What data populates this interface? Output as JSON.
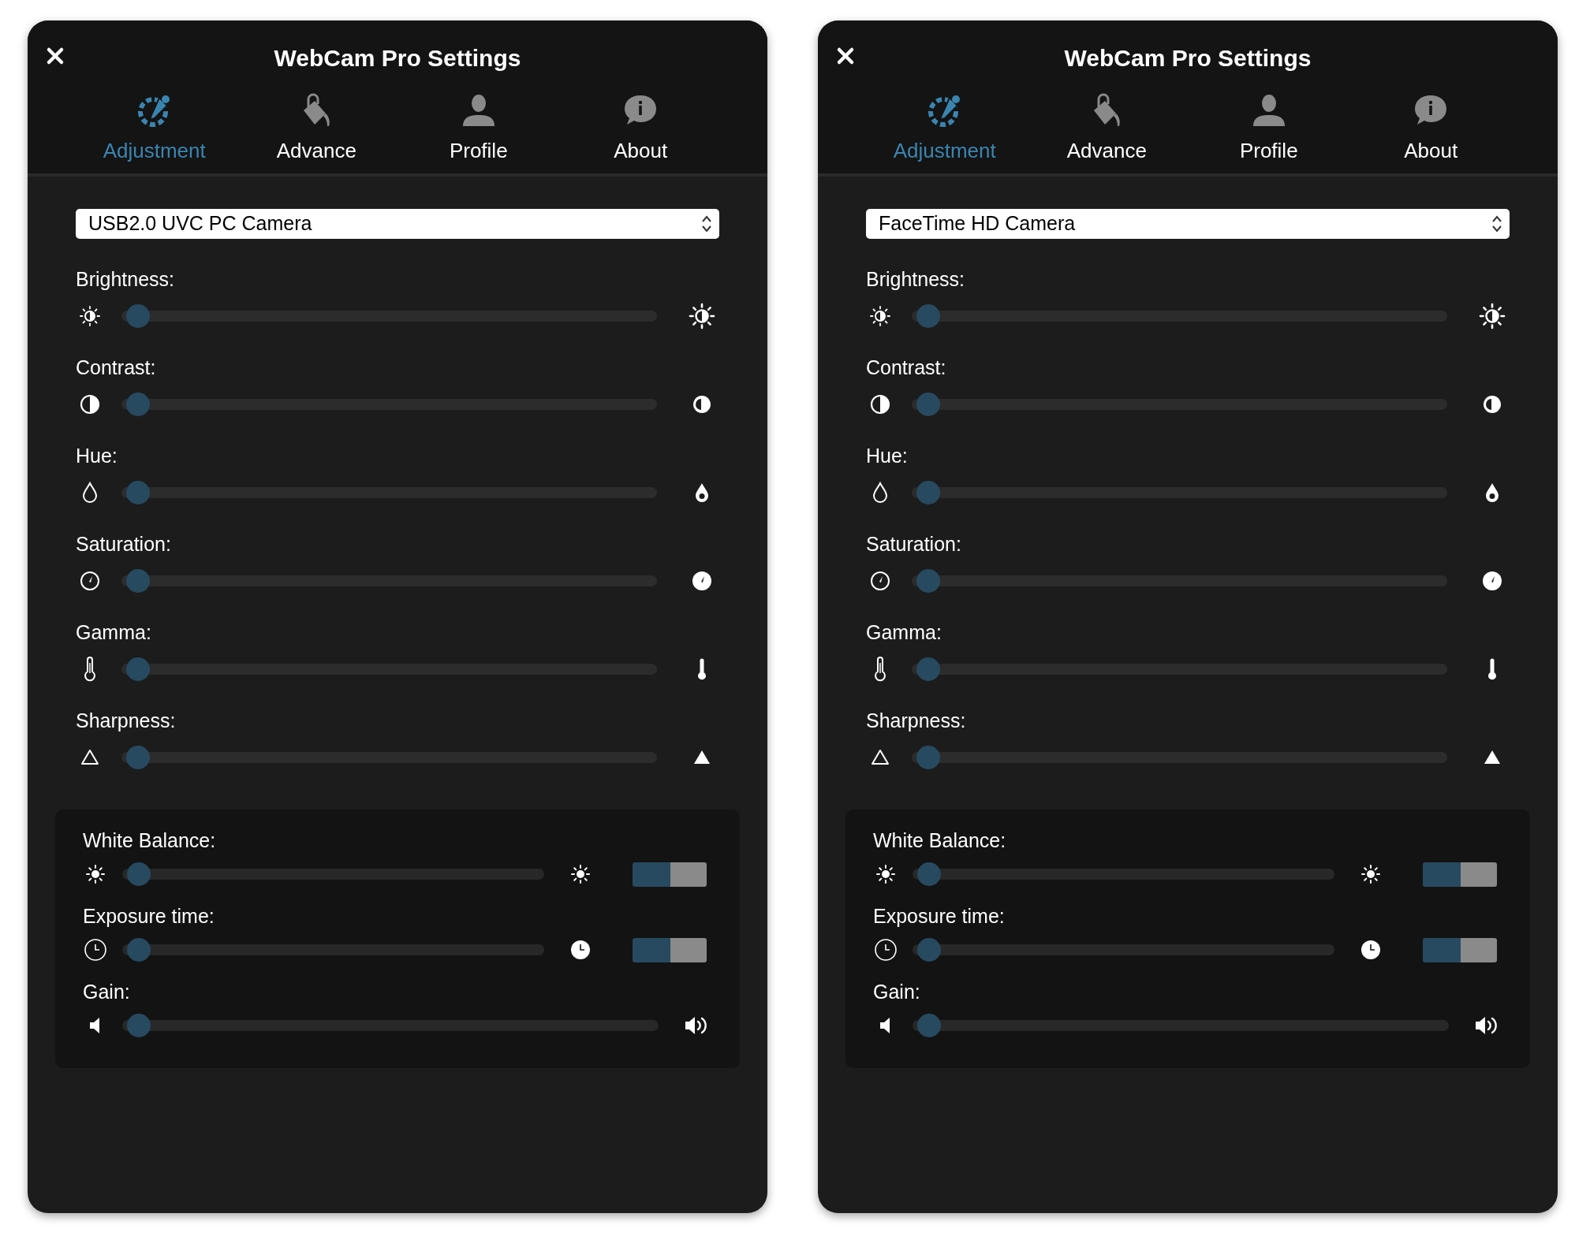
{
  "panels": [
    {
      "title": "WebCam Pro Settings",
      "tabs": [
        {
          "label": "Adjustment",
          "selected": true
        },
        {
          "label": "Advance",
          "selected": false
        },
        {
          "label": "Profile",
          "selected": false
        },
        {
          "label": "About",
          "selected": false
        }
      ],
      "camera_select": {
        "value": "USB2.0 UVC PC Camera"
      },
      "sliders": [
        {
          "label": "Brightness:",
          "level": 0
        },
        {
          "label": "Contrast:",
          "level": 0
        },
        {
          "label": "Hue:",
          "level": 0
        },
        {
          "label": "Saturation:",
          "level": 0
        },
        {
          "label": "Gamma:",
          "level": 0
        },
        {
          "label": "Sharpness:",
          "level": 0
        }
      ],
      "advanced": [
        {
          "label": "White Balance:",
          "kind": "auto",
          "level": 0,
          "on": true
        },
        {
          "label": "Exposure time:",
          "kind": "auto",
          "level": 0,
          "on": true
        },
        {
          "label": "Gain:",
          "kind": "plain",
          "level": 0
        }
      ]
    },
    {
      "title": "WebCam Pro Settings",
      "tabs": [
        {
          "label": "Adjustment",
          "selected": true
        },
        {
          "label": "Advance",
          "selected": false
        },
        {
          "label": "Profile",
          "selected": false
        },
        {
          "label": "About",
          "selected": false
        }
      ],
      "camera_select": {
        "value": "FaceTime HD Camera"
      },
      "sliders": [
        {
          "label": "Brightness:",
          "level": 0
        },
        {
          "label": "Contrast:",
          "level": 0
        },
        {
          "label": "Hue:",
          "level": 0
        },
        {
          "label": "Saturation:",
          "level": 0
        },
        {
          "label": "Gamma:",
          "level": 0
        },
        {
          "label": "Sharpness:",
          "level": 0
        }
      ],
      "advanced": [
        {
          "label": "White Balance:",
          "kind": "auto",
          "level": 0,
          "on": true
        },
        {
          "label": "Exposure time:",
          "kind": "auto",
          "level": 0,
          "on": true
        },
        {
          "label": "Gain:",
          "kind": "plain",
          "level": 0
        }
      ]
    }
  ]
}
